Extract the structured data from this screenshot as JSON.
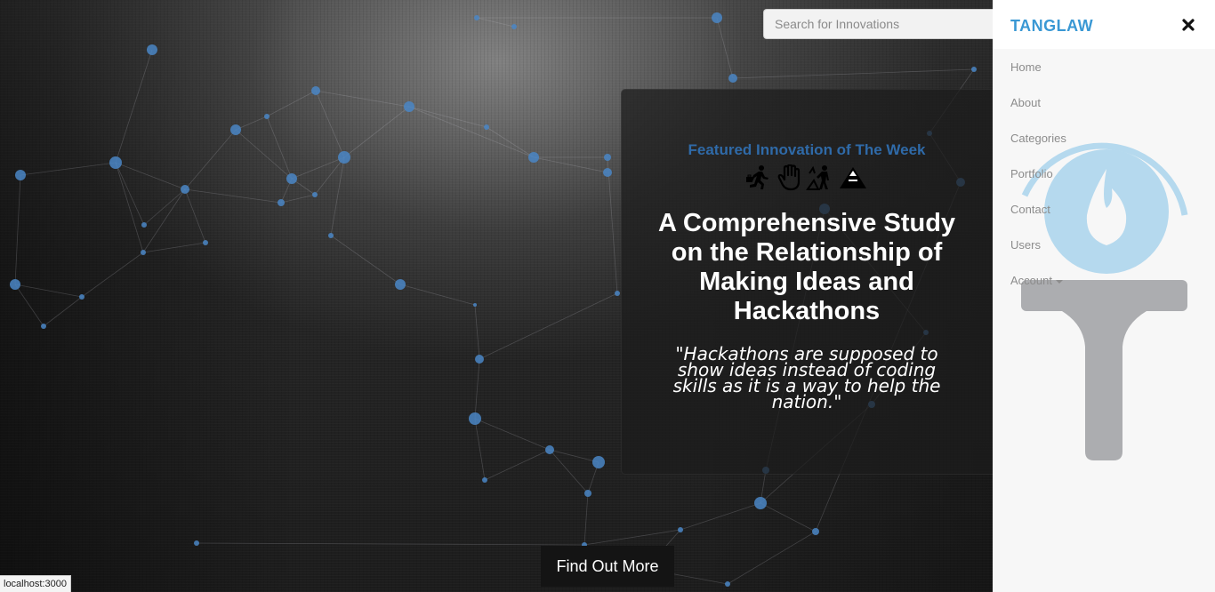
{
  "search": {
    "placeholder": "Search for Innovations"
  },
  "featured": {
    "label": "Featured Innovation of The Week",
    "icons": [
      "running-with-briefcase-icon",
      "raised-hand-icon",
      "camping-icon",
      "triangle-mountain-icon"
    ],
    "title": "A Comprehensive Study on the Relationship of Making Ideas and Hackathons",
    "quote": "\"Hackathons are supposed to show ideas instead of coding skills as it is a way to help the nation.\""
  },
  "cta": {
    "label": "Find Out More"
  },
  "status_bar": {
    "url": "localhost:3000"
  },
  "sidenav": {
    "brand": "TANGLAW",
    "close_icon": "close-icon",
    "items": [
      {
        "label": "Home"
      },
      {
        "label": "About"
      },
      {
        "label": "Categories"
      },
      {
        "label": "Portfolio"
      },
      {
        "label": "Contact"
      },
      {
        "label": "Users"
      },
      {
        "label": "Account",
        "dropdown": true
      }
    ],
    "watermark_icon": "torch-flame-logo-icon"
  },
  "colors": {
    "brand": "#3a98d4",
    "featured_label": "#2f6aa8",
    "network_nodes": "#4a86c5",
    "sidenav_bg": "#f7f7f7",
    "torch_flame": "#a8d5ee",
    "torch_handle": "#a9aaad"
  }
}
